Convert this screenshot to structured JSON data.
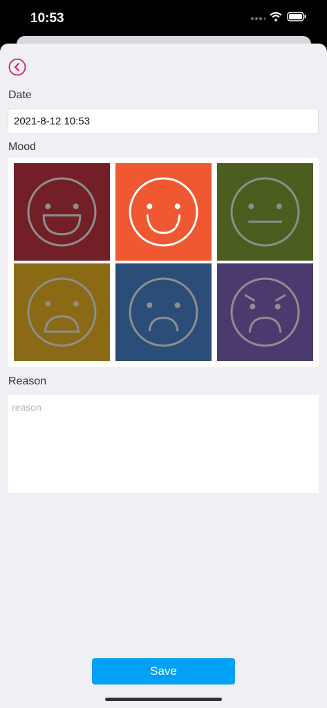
{
  "status": {
    "time": "10:53"
  },
  "form": {
    "date_label": "Date",
    "date_value": "2021-8-12 10:53",
    "mood_label": "Mood",
    "reason_label": "Reason",
    "reason_placeholder": "reason",
    "reason_value": "",
    "save_label": "Save"
  },
  "moods": [
    {
      "icon": "laughing-face-icon",
      "color": "#731f28",
      "selected": false
    },
    {
      "icon": "smiling-face-icon",
      "color": "#ef5830",
      "selected": true
    },
    {
      "icon": "neutral-face-icon",
      "color": "#4b5e20",
      "selected": false
    },
    {
      "icon": "shocked-face-icon",
      "color": "#8a6a15",
      "selected": false
    },
    {
      "icon": "sad-face-icon",
      "color": "#2c4d78",
      "selected": false
    },
    {
      "icon": "angry-face-icon",
      "color": "#4a3a6e",
      "selected": false
    }
  ],
  "colors": {
    "accent": "#03a1f5",
    "back_icon": "#d0205a",
    "face_stroke": "#8e8e8e",
    "face_stroke_selected": "#ffffff"
  }
}
